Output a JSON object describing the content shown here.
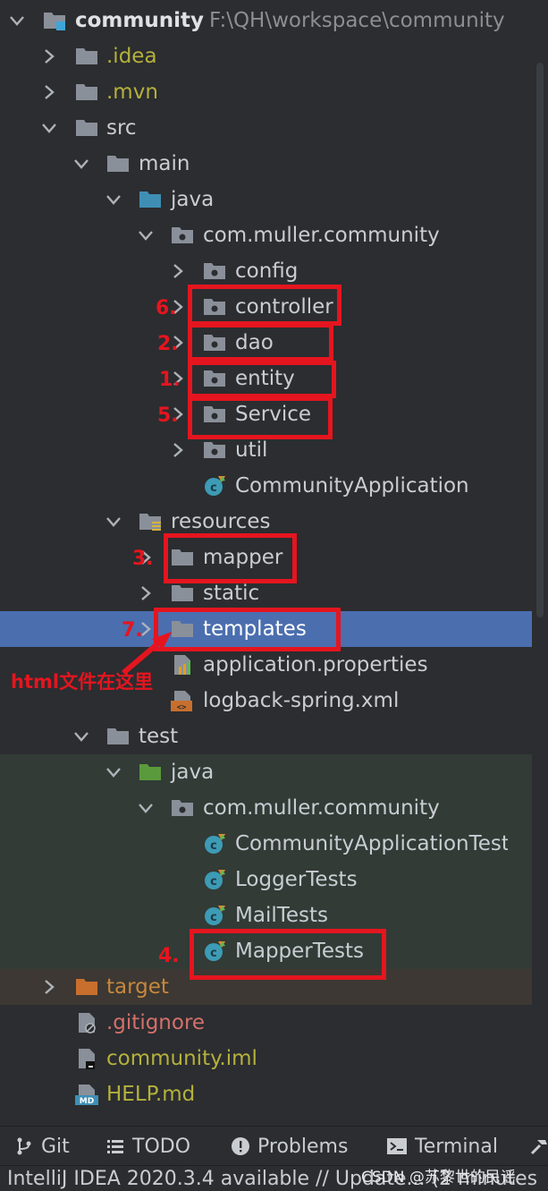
{
  "project": {
    "name": "community",
    "path": "F:\\QH\\workspace\\community"
  },
  "tree": {
    "idea": ".idea",
    "mvn": ".mvn",
    "src": "src",
    "main": "main",
    "java": "java",
    "package": "com.muller.community",
    "config": "config",
    "controller": "controller",
    "dao": "dao",
    "entity": "entity",
    "service": "Service",
    "util": "util",
    "app_class": "CommunityApplication",
    "resources": "resources",
    "mapper": "mapper",
    "static": "static",
    "templates": "templates",
    "app_props": "application.properties",
    "logback": "logback-spring.xml",
    "test": "test",
    "test_java": "java",
    "test_package": "com.muller.community",
    "test_app": "CommunityApplicationTest",
    "logger_tests": "LoggerTests",
    "mail_tests": "MailTests",
    "mapper_tests": "MapperTests",
    "target": "target",
    "gitignore": ".gitignore",
    "iml": "community.iml",
    "help": "HELP.md"
  },
  "annotations": {
    "n6": "6.",
    "n2": "2.",
    "n1": "1.",
    "n5": "5.",
    "n3": "3.",
    "n7": "7.",
    "n4": "4.",
    "note": "html文件在这里"
  },
  "toolbar": {
    "git": "Git",
    "todo": "TODO",
    "problems": "Problems",
    "terminal": "Terminal"
  },
  "status": {
    "message": "IntelliJ IDEA 2020.3.4 available // Update... (2 minutes",
    "watermark": "CSDN @苏黎世的民谣"
  },
  "colors": {
    "selection": "#4b6eaf",
    "annotation": "#e5151f",
    "folder": "#8a9099",
    "source_folder": "#3f8fb5",
    "test_folder": "#5b9a3c"
  }
}
